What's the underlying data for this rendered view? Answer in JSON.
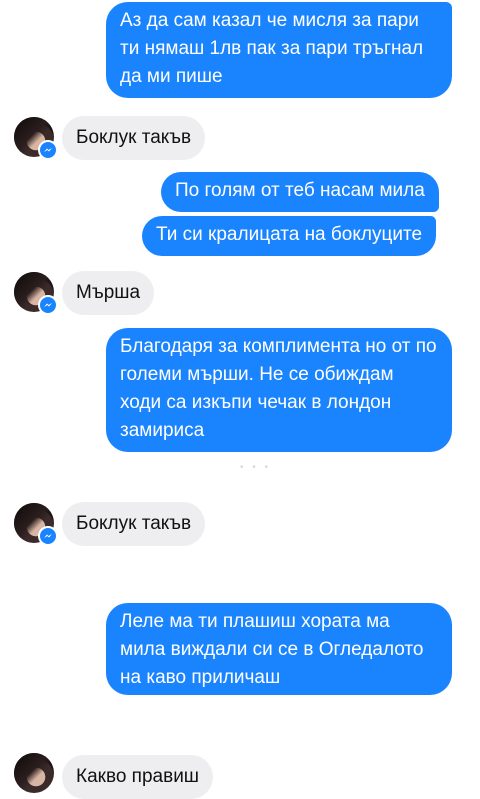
{
  "messages": [
    {
      "side": "out",
      "text": "Аз да сам казал че мисля за пари ти нямаш 1лв пак за пари тръгнал да ми пише"
    },
    {
      "side": "in",
      "text": "Боклук такъв"
    },
    {
      "side": "out",
      "text": "По голям от теб насам мила"
    },
    {
      "side": "out",
      "text": "Ти си кралицата на боклуците"
    },
    {
      "side": "in",
      "text": "Мърша"
    },
    {
      "side": "out",
      "text": "Благодаря за комплимента но от по големи мърши. Не се обиждам ходи са изкъпи чечак в лондон замириса"
    },
    {
      "side": "in",
      "text": "Боклук такъв"
    },
    {
      "side": "out",
      "text": "Леле ма ти плашиш хората ма мила виждали си се в Огледалото на каво приличаш"
    },
    {
      "side": "in",
      "text": "Какво правиш"
    }
  ],
  "colors": {
    "outgoing": "#1a84ff",
    "incoming": "#eeeef0",
    "badge": "#1a84ff"
  },
  "icons": {
    "avatar_badge": "messenger-bolt-icon"
  }
}
